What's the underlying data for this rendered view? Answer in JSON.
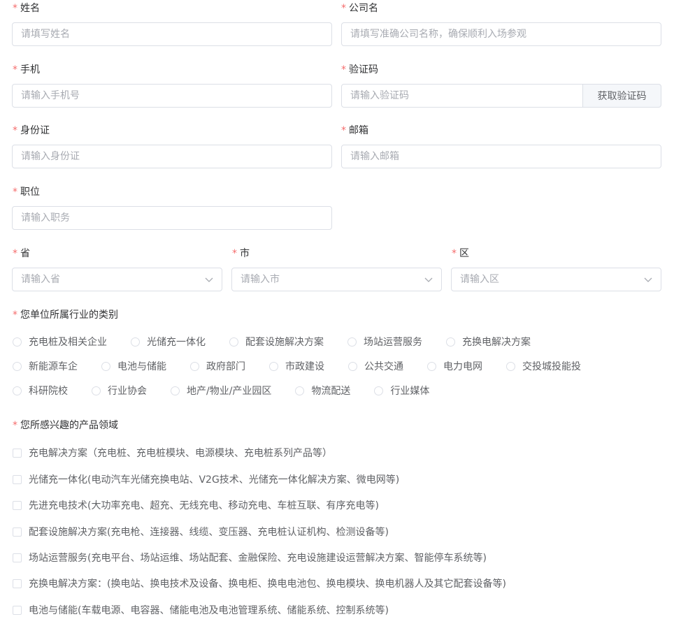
{
  "fields": {
    "name": {
      "label": "姓名",
      "placeholder": "请填写姓名"
    },
    "company": {
      "label": "公司名",
      "placeholder": "请填写准确公司名称，确保顺利入场参观"
    },
    "phone": {
      "label": "手机",
      "placeholder": "请输入手机号"
    },
    "code": {
      "label": "验证码",
      "placeholder": "请输入验证码",
      "button": "获取验证码"
    },
    "id_card": {
      "label": "身份证",
      "placeholder": "请输入身份证"
    },
    "email": {
      "label": "邮箱",
      "placeholder": "请输入邮箱"
    },
    "position": {
      "label": "职位",
      "placeholder": "请输入职务"
    },
    "province": {
      "label": "省",
      "placeholder": "请输入省"
    },
    "city": {
      "label": "市",
      "placeholder": "请输入市"
    },
    "district": {
      "label": "区",
      "placeholder": "请输入区"
    }
  },
  "required_mark": "*",
  "industry": {
    "label": "您单位所属行业的类别",
    "options": [
      "充电桩及相关企业",
      "光储充一体化",
      "配套设施解决方案",
      "场站运营服务",
      "充换电解决方案",
      "新能源车企",
      "电池与储能",
      "政府部门",
      "市政建设",
      "公共交通",
      "电力电网",
      "交投城投能投",
      "科研院校",
      "行业协会",
      "地产/物业/产业园区",
      "物流配送",
      "行业媒体"
    ]
  },
  "products": {
    "label": "您所感兴趣的产品领域",
    "options": [
      "充电解决方案（充电桩、充电桩模块、电源模块、充电桩系列产品等）",
      "光储充一体化(电动汽车光储充换电站、V2G技术、光储充一体化解决方案、微电网等)",
      "先进充电技术(大功率充电、超充、无线充电、移动充电、车桩互联、有序充电等)",
      "配套设施解决方案(充电枪、连接器、线缆、变压器、充电桩认证机构、检测设备等)",
      "场站运营服务(充电平台、场站运维、场站配套、金融保险、充电设施建设运营解决方案、智能停车系统等)",
      "充换电解决方案：(换电站、换电技术及设备、换电柜、换电电池包、换电模块、换电机器人及其它配套设备等)",
      "电池与储能(车载电源、电容器、储能电池及电池管理系统、储能系统、控制系统等)"
    ]
  },
  "colors": {
    "required": "#f56c6c",
    "border": "#dcdfe6",
    "placeholder": "#a8abb2"
  }
}
